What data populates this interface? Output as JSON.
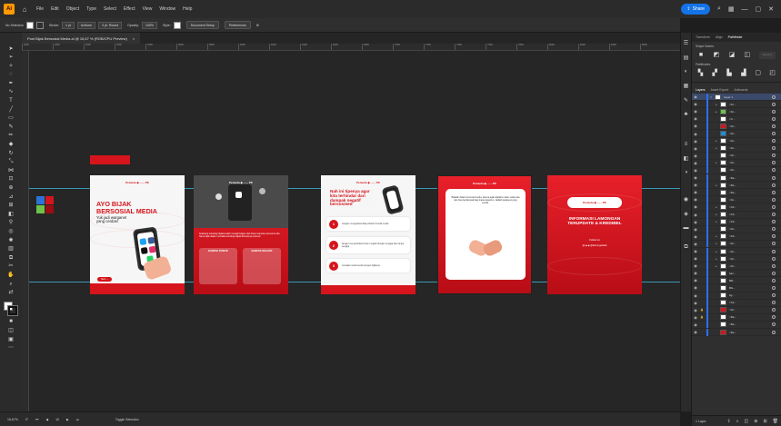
{
  "colors": {
    "accent": "#1473e6",
    "brand_red": "#d6141c",
    "guide": "#3fb6d8",
    "layer_bar": "#2e6ef5"
  },
  "menubar": {
    "logo": "Ai",
    "items": [
      "File",
      "Edit",
      "Object",
      "Type",
      "Select",
      "Effect",
      "View",
      "Window",
      "Help"
    ],
    "share_label": "Share"
  },
  "controlbar": {
    "selection": "No Selection",
    "stroke_label": "Stroke:",
    "stroke_value": "1 pt",
    "uniform": "Uniform",
    "round": "3 pt. Round",
    "opacity_label": "Opacity:",
    "opacity_value": "100%",
    "style_label": "Style:",
    "document_setup": "Document Setup",
    "preferences": "Preferences"
  },
  "document": {
    "tab_title": "Post Bijak Bersosial Media.ai @ 16,67 % (RGB/CPU Preview)",
    "close": "×"
  },
  "ruler_ticks": [
    "4600",
    "4800",
    "5000",
    "5200",
    "5400",
    "5600",
    "5800",
    "6000",
    "6200",
    "6400",
    "6600",
    "6800",
    "7000",
    "7200",
    "7400",
    "7600",
    "7800",
    "8000",
    "8200",
    "8400",
    "8600"
  ],
  "artboards": {
    "a1": {
      "brand": "Pemuda ◆ ~~~ PK",
      "headline": "AYO BIJAK\nBERSOSIAL MEDIA",
      "subline": "Yuk jadi warganet\nyang cerdas!",
      "pill": "Next →"
    },
    "a2": {
      "brand": "Pemuda ◆ ~~~ PK",
      "body": "Sekarang teknologi digital sudah menjadi bagian dari hidup manusia, karena itu kita harus bijak dalam memakai teknologi digital khususnya sosmed",
      "card1_title": "DAMPAK POSITIF",
      "card2_title": "DAMPAK NEGATIF"
    },
    "a3": {
      "brand": "Pemuda ◆ ~~~ PK",
      "headline": "Nah ini tipenya agar\nkita terhindar dari\ndampak negatif\nbersosmed",
      "rows": [
        {
          "num": "1",
          "text": "Jangan mengupload data pribadi di sosial media"
        },
        {
          "num": "2",
          "text": "Jangan menyebarkan konten negatif dengan sengaja atau tanpa sengaja"
        },
        {
          "num": "3",
          "text": "Gunakan sosial media dengan bijaknya"
        }
      ]
    },
    "a4": {
      "brand": "Pemuda ◆ ~~~ PK",
      "body": "Bijaklah dalam bersosial media, karena jejak digitalmu akan selalu ada dan bisa berdampak bagi masa depanmu. Jadilah warganet yang cerdas."
    },
    "a5": {
      "brand": "Pemuda ◆ ~~~ PK",
      "headline": "INFORMASI LAMONGAN\nTERUPDATE & KREDIBEL",
      "follow": "Follow Us",
      "handles": "@ ◆ ◆ @lamongankab"
    }
  },
  "statusbar": {
    "zoom": "16,67%",
    "rotation": "0°",
    "artboard_nav": "10",
    "tool_hint": "Toggle Selection"
  },
  "panel": {
    "top_tabs": [
      "Transform",
      "Align",
      "Pathfinder"
    ],
    "shape_modes": "Shape Modes:",
    "pathfinders": "Pathfinders:",
    "expand": "Expand",
    "layer_tabs": [
      "Layers",
      "Asset Export",
      "Artboards"
    ],
    "layer1": "Layer 1",
    "layers": [
      "<Gr...",
      "<Gr...",
      "<C...",
      "<Gr...",
      "<Gr...",
      "<Gr...",
      "<Gr...",
      "<Gr...",
      "<Gr...",
      "<Gr...",
      "<Re...",
      "<Re...",
      "<Re...",
      "<Gr...",
      "<Cli...",
      "<Cli...",
      "<Cli...",
      "<Gr...",
      "<Cli...",
      "<Gr...",
      "<Gr...",
      "<Gr...",
      "<Gr...",
      "bac...",
      "BR...",
      "BG...",
      "bg...",
      "<Cli...",
      "<Gr...",
      "<Re...",
      "<Re...",
      "<Re..."
    ],
    "footer": "1 Layer"
  }
}
